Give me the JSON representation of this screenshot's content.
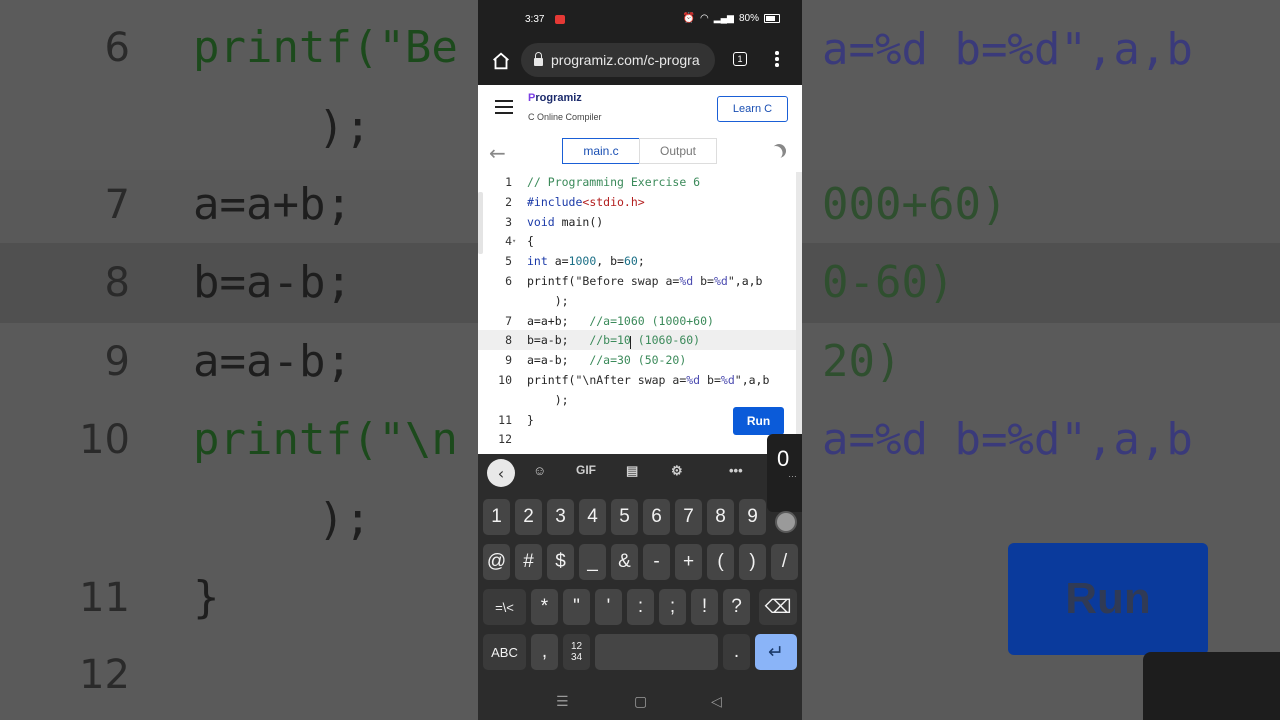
{
  "background": {
    "lines": [
      {
        "num": "6",
        "code": "printf(\"Be"
      },
      {
        "num": "",
        "code": ");"
      },
      {
        "num": "7",
        "code": "a=a+b;"
      },
      {
        "num": "8",
        "code": "b=a-b;"
      },
      {
        "num": "9",
        "code": "a=a-b;"
      },
      {
        "num": "10",
        "code": "printf(\"\\n"
      },
      {
        "num": "",
        "code": ");"
      },
      {
        "num": "11",
        "code": "}"
      },
      {
        "num": "12",
        "code": ""
      }
    ],
    "right_fragments": [
      "a=%d b=%d\",a,b",
      "000+60)",
      "0-60)",
      "20)",
      "a=%d b=%d\",a,b"
    ],
    "run_label": "Run"
  },
  "status_bar": {
    "time": "3:37",
    "battery": "80%"
  },
  "browser": {
    "url": "programiz.com/c-progra",
    "tab_count": "1"
  },
  "site": {
    "logo": "Programiz",
    "subtitle": "C Online Compiler",
    "learn_button": "Learn C"
  },
  "toolbar": {
    "tabs": [
      {
        "label": "main.c",
        "active": true
      },
      {
        "label": "Output",
        "active": false
      }
    ]
  },
  "editor": {
    "lines": [
      {
        "num": "1",
        "html": "<span class='com'>// Programming Exercise 6</span>"
      },
      {
        "num": "2",
        "html": "<span class='kw'>#include</span><span class='inc'>&lt;stdio.h&gt;</span>"
      },
      {
        "num": "3",
        "html": "<span class='kw'>void</span> main()"
      },
      {
        "num": "4",
        "html": "{",
        "fold": true
      },
      {
        "num": "5",
        "html": "<span class='kw'>int</span> a=<span class='num'>1000</span>, b=<span class='num'>60</span>;"
      },
      {
        "num": "6",
        "html": "printf(<span class='str'>\"Before swap a=</span><span class='fmt'>%d</span><span class='str'> b=</span><span class='fmt'>%d</span><span class='str'>\"</span>,a,b"
      },
      {
        "num": "",
        "html": "    );"
      },
      {
        "num": "7",
        "html": "a=a+b;   <span class='com'>//a=1060 (1000+60)</span>"
      },
      {
        "num": "8",
        "html": "b=a-b;   <span class='com'>//b=10 (1060-60)</span>",
        "highlight": true
      },
      {
        "num": "9",
        "html": "a=a-b;   <span class='com'>//a=30 (50-20)</span>"
      },
      {
        "num": "10",
        "html": "printf(<span class='str'>\"\\nAfter swap a=</span><span class='fmt'>%d</span><span class='str'> b=</span><span class='fmt'>%d</span><span class='str'>\"</span>,a,b"
      },
      {
        "num": "",
        "html": "    );"
      },
      {
        "num": "11",
        "html": "}"
      },
      {
        "num": "12",
        "html": ""
      }
    ],
    "run_label": "Run"
  },
  "keyboard": {
    "toolbar": [
      "sticker-icon",
      "GIF",
      "clipboard-icon",
      "gear-icon",
      "more-icon"
    ],
    "suggestion": "0",
    "row1": [
      "1",
      "2",
      "3",
      "4",
      "5",
      "6",
      "7",
      "8",
      "9"
    ],
    "row2": [
      "@",
      "#",
      "$",
      "_",
      "&",
      "-",
      "+",
      "(",
      ")",
      "/"
    ],
    "row3": [
      "=\\<",
      "*",
      "\"",
      "'",
      ":",
      ";",
      "!",
      "?"
    ],
    "row4": {
      "abc": "ABC",
      "comma": ",",
      "numsym": "12\n34",
      "period": "."
    }
  }
}
